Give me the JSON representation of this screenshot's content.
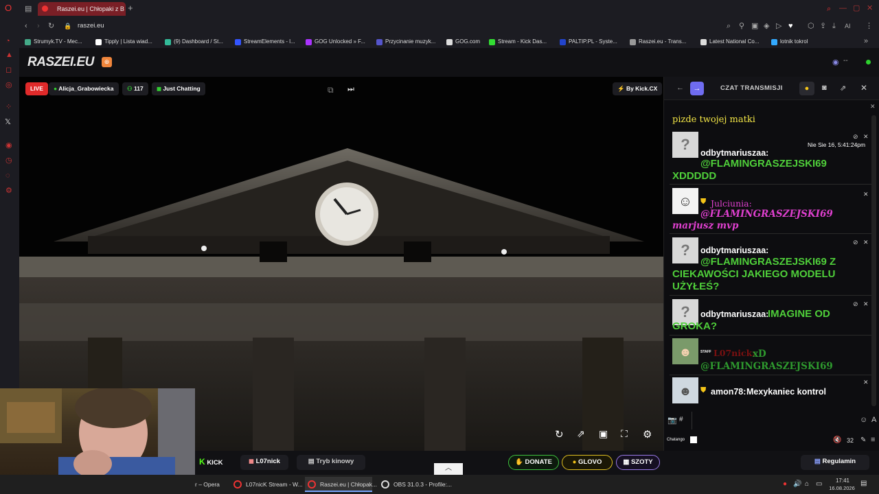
{
  "browser": {
    "tabs": [
      {
        "label": "Raszei.eu | Chłopaki z B",
        "active": true
      }
    ],
    "address": "raszei.eu",
    "bookmarks": [
      {
        "label": "Strumyk.TV - Mec...",
        "color": "#4a8"
      },
      {
        "label": "Tipply | Lista wiad...",
        "color": "#fff"
      },
      {
        "label": "(9) Dashboard / St...",
        "color": "#3b9"
      },
      {
        "label": "StreamElements - l...",
        "color": "#35f"
      },
      {
        "label": "GOG Unlocked » F...",
        "color": "#a3f"
      },
      {
        "label": "Przycinanie muzyk...",
        "color": "#55c"
      },
      {
        "label": "GOG.com",
        "color": "#ddd"
      },
      {
        "label": "Stream - Kick Das...",
        "color": "#3d3"
      },
      {
        "label": "PALTIP.PL - Syste...",
        "color": "#24c"
      },
      {
        "label": "Raszei.eu - Trans...",
        "color": "#999"
      },
      {
        "label": "Latest National Co...",
        "color": "#ddd"
      },
      {
        "label": "lotnik tokrol",
        "color": "#3af"
      }
    ],
    "toolbar_ai": "AI"
  },
  "site": {
    "logo": "RASZEI.EU",
    "viewer_status": "--"
  },
  "player": {
    "live_label": "LIVE",
    "streamer": "Alicja_Grabowiecka",
    "viewers": "117",
    "category": "Just Chatting",
    "source": "By Kick.CX"
  },
  "chat": {
    "title": "CZAT TRANSMISJI",
    "pinned_text": "pizde twojej matki",
    "messages": [
      {
        "user": "odbytmariuszaa:",
        "text": "@FLAMINGRASZEJSKI69 XDDDDD",
        "timestamp": "Nie Sie 16, 5:41:24pm"
      },
      {
        "user": "Julciunia:",
        "text": "@FLAMINGRASZEJSKI69 marjusz mvp"
      },
      {
        "user": "odbytmariuszaa:",
        "text": "@FLAMINGRASZEJSKI69 Z CIEKAWOŚCI JAKIEGO MODELU UŻYŁEŚ?"
      },
      {
        "user": "odbytmariuszaa:",
        "text": "IMAGINE OD GROKA?"
      },
      {
        "user": "L07nick:",
        "text": "xD @FLAMINGRASZEJSKI69",
        "badge": "STAFF"
      },
      {
        "user": "amon78:",
        "text": "Mexykaniec kontrol"
      }
    ],
    "input_prefix": "#",
    "footer_label": "Chatango",
    "volume": "32"
  },
  "bottom": {
    "kick": "KICK",
    "channel": "L07nick",
    "cinema": "Tryb kinowy",
    "donate": "DONATE",
    "glovo": "GLOVO",
    "szoty": "SZOTY",
    "rules": "Regulamin"
  },
  "taskbar": {
    "items": [
      "r – Opera",
      "L07nicK Stream - W...",
      "Raszei.eu | Chłopak...",
      "OBS 31.0.3 - Profile:..."
    ],
    "time": "17:41",
    "date": "16.08.2026"
  }
}
